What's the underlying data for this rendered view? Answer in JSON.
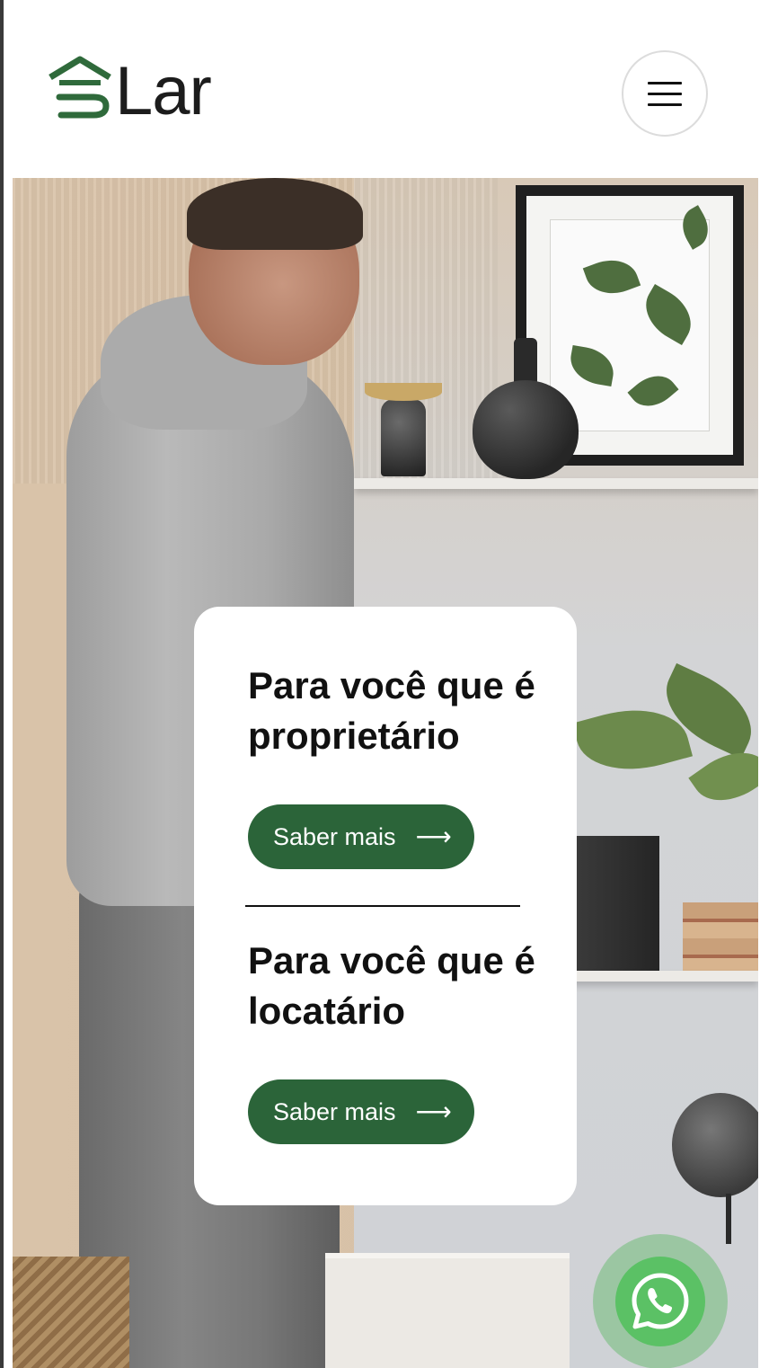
{
  "header": {
    "logo_text": "Lar",
    "menu_button_icon": "hamburger-menu-icon"
  },
  "hero": {
    "image_description_icon": "hero-photo",
    "card": {
      "owner_title": "Para você que é proprietário",
      "owner_button_label": "Saber mais",
      "tenant_title": "Para você que é locatário",
      "tenant_button_label": "Saber mais",
      "arrow_icon": "arrow-right-icon",
      "button_color": "#2b6439"
    }
  },
  "floating": {
    "whatsapp_icon": "whatsapp-icon",
    "whatsapp_color": "#5bc165"
  },
  "colors": {
    "brand_green": "#2b6439",
    "logo_green": "#2f6a3b",
    "text": "#111111"
  }
}
